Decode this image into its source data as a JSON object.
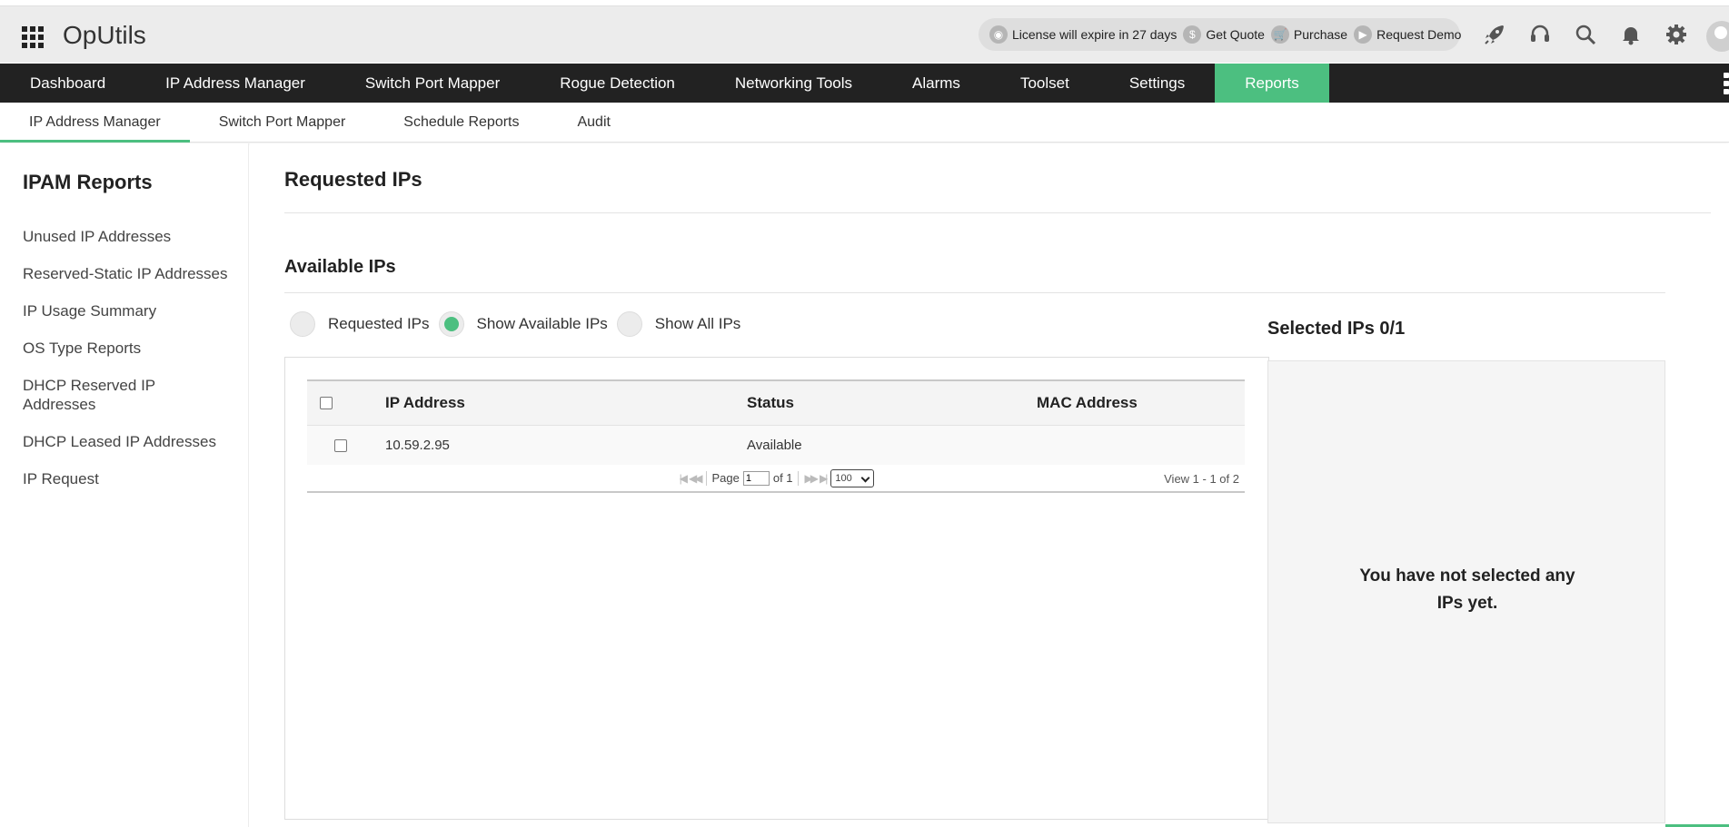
{
  "header": {
    "app_title": "OpUtils",
    "license_text": "License will expire in 27 days",
    "get_quote": "Get Quote",
    "purchase": "Purchase",
    "request_demo": "Request Demo",
    "icons": [
      "rocket-icon",
      "headset-icon",
      "search-icon",
      "bell-icon",
      "gear-icon",
      "avatar"
    ]
  },
  "main_nav": {
    "items": [
      "Dashboard",
      "IP Address Manager",
      "Switch Port Mapper",
      "Rogue Detection",
      "Networking Tools",
      "Alarms",
      "Toolset",
      "Settings",
      "Reports"
    ],
    "active": "Reports",
    "accent_color": "#4cbf80"
  },
  "sub_nav": {
    "items": [
      "IP Address Manager",
      "Switch Port Mapper",
      "Schedule Reports",
      "Audit"
    ],
    "active": "IP Address Manager"
  },
  "sidebar": {
    "title": "IPAM Reports",
    "links": [
      "Unused IP Addresses",
      "Reserved-Static IP Addresses",
      "IP Usage Summary",
      "OS Type Reports",
      "DHCP Reserved IP Addresses",
      "DHCP Leased IP Addresses",
      "IP Request"
    ]
  },
  "main": {
    "page_title": "Requested IPs",
    "section_title": "Available IPs",
    "radios": [
      {
        "label": "Requested IPs",
        "checked": false
      },
      {
        "label": "Show Available IPs",
        "checked": true
      },
      {
        "label": "Show All IPs",
        "checked": false
      }
    ],
    "table": {
      "columns": [
        "IP Address",
        "Status",
        "MAC Address"
      ],
      "rows": [
        {
          "ip": "10.59.2.95",
          "status": "Available",
          "mac": ""
        }
      ]
    },
    "pager": {
      "page_label": "Page",
      "page_value": "1",
      "of_label": "of 1",
      "page_size": "100",
      "view_text": "View 1 - 1 of 2"
    },
    "selected": {
      "title": "Selected IPs 0/1",
      "empty_message": "You have not selected any IPs yet."
    }
  }
}
